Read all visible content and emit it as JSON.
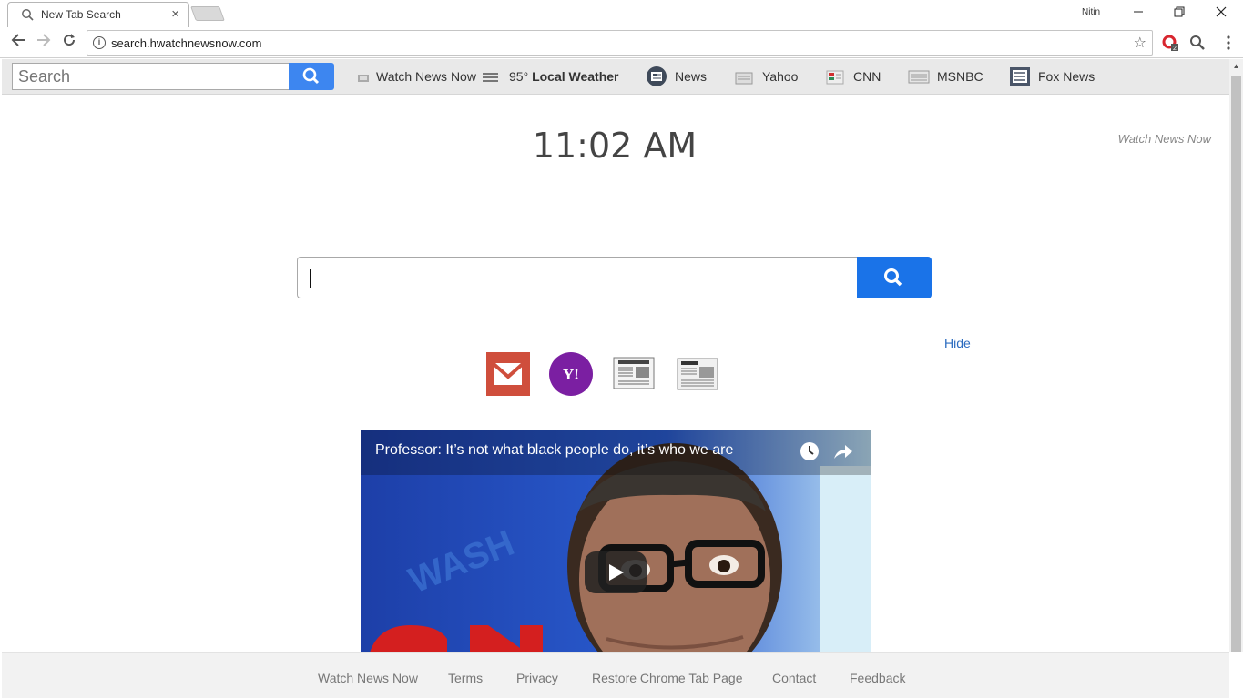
{
  "browser": {
    "tab_title": "New Tab Search",
    "tab_close": "×",
    "user_name": "Nitin",
    "url": "search.hwatchnewsnow.com",
    "extension_badge": "2"
  },
  "navbar": {
    "search_placeholder": "Search",
    "links": [
      {
        "label": "Watch News Now",
        "icon": "tv-icon"
      },
      {
        "label": "95°",
        "bold": "Local Weather",
        "icon": "weather-icon"
      },
      {
        "label": "News",
        "icon": "news-icon"
      },
      {
        "label": "Yahoo",
        "icon": "yahoo-icon"
      },
      {
        "label": "CNN",
        "icon": "cnn-icon"
      },
      {
        "label": "MSNBC",
        "icon": "msnbc-icon"
      },
      {
        "label": "Fox News",
        "icon": "fox-news-icon"
      }
    ]
  },
  "main": {
    "time": "11:02 AM",
    "brand": "Watch News Now",
    "hide_label": "Hide",
    "quick_links": [
      "gmail-icon",
      "yahoo-icon",
      "newspaper-icon",
      "daily-news-icon"
    ],
    "video_title": "Professor: It’s not what black people do, it’s who we are"
  },
  "footer": {
    "links": [
      "Watch News Now",
      "Terms",
      "Privacy",
      "Restore Chrome Tab Page",
      "Contact",
      "Feedback"
    ]
  },
  "colors": {
    "search_button": "#1a73e8",
    "navbar_bg": "#e9e9e9",
    "gmail_red": "#cf4e3c",
    "yahoo_purple": "#7b1fa2",
    "link_blue": "#2b6bbf"
  }
}
